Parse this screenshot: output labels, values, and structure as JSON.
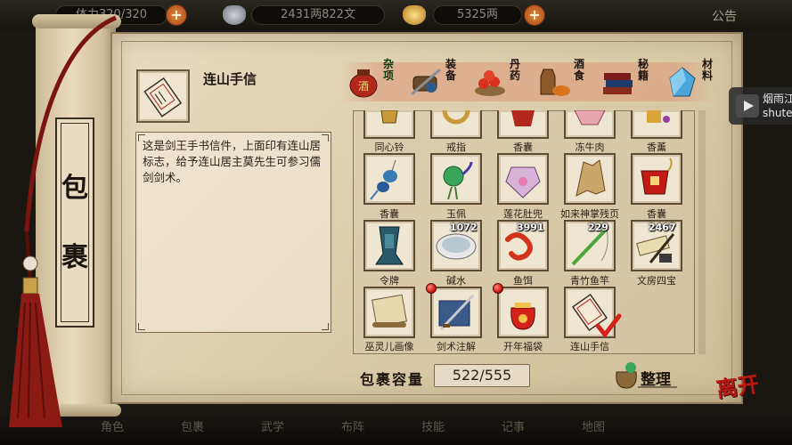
{
  "topbar": {
    "stamina_label": "体力",
    "stamina_value": "320/320",
    "money_value": "2431两822文",
    "gold_value": "5325两",
    "notice_label": "公告",
    "plus_symbol": "+"
  },
  "scroll": {
    "title_chars": [
      "包",
      "裹"
    ]
  },
  "selected": {
    "name": "连山手信",
    "description": "这是剑王手书信件，上面印有连山居标志，给予连山居主莫先生可参习儒剑剑术。"
  },
  "categories": [
    {
      "label": "杂项",
      "icon": "jar-icon",
      "active": true
    },
    {
      "label": "装备",
      "icon": "equipment-icon",
      "active": false
    },
    {
      "label": "丹药",
      "icon": "pills-icon",
      "active": false
    },
    {
      "label": "酒食",
      "icon": "wine-food-icon",
      "active": false
    },
    {
      "label": "秘籍",
      "icon": "books-icon",
      "active": false
    },
    {
      "label": "材料",
      "icon": "crystal-icon",
      "active": false
    }
  ],
  "items": [
    {
      "name": "同心铃",
      "qty": "",
      "icon": "bell-icon",
      "new": false
    },
    {
      "name": "戒指",
      "qty": "",
      "icon": "ring-icon",
      "new": false
    },
    {
      "name": "香囊",
      "qty": "",
      "icon": "sachet-icon",
      "new": false
    },
    {
      "name": "冻牛肉",
      "qty": "",
      "icon": "beef-icon",
      "new": false
    },
    {
      "name": "香薰",
      "qty": "",
      "icon": "incense-icon",
      "new": false
    },
    {
      "name": "香囊",
      "qty": "",
      "icon": "blue-sachet-icon",
      "new": false
    },
    {
      "name": "玉佩",
      "qty": "",
      "icon": "jade-pendant-icon",
      "new": false
    },
    {
      "name": "莲花肚兜",
      "qty": "",
      "icon": "bib-icon",
      "new": false
    },
    {
      "name": "如来神掌残页",
      "qty": "",
      "icon": "torn-page-icon",
      "new": false
    },
    {
      "name": "香囊",
      "qty": "",
      "icon": "red-sachet-icon",
      "new": false
    },
    {
      "name": "令牌",
      "qty": "",
      "icon": "token-icon",
      "new": false
    },
    {
      "name": "碱水",
      "qty": "1072",
      "icon": "bowl-icon",
      "new": false
    },
    {
      "name": "鱼饵",
      "qty": "3991",
      "icon": "worm-icon",
      "new": false
    },
    {
      "name": "青竹鱼竿",
      "qty": "229",
      "icon": "fishing-rod-icon",
      "new": false
    },
    {
      "name": "文房四宝",
      "qty": "2467",
      "icon": "scholar-set-icon",
      "new": false
    },
    {
      "name": "巫灵儿画像",
      "qty": "",
      "icon": "portrait-scroll-icon",
      "new": false
    },
    {
      "name": "剑术注解",
      "qty": "",
      "icon": "sword-manual-icon",
      "new": true
    },
    {
      "name": "开年福袋",
      "qty": "",
      "icon": "lucky-bag-icon",
      "new": true
    },
    {
      "name": "连山手信",
      "qty": "",
      "icon": "letter-icon",
      "new": false,
      "selected": true
    }
  ],
  "footer": {
    "capacity_label": "包裹容量",
    "capacity_value": "522/555",
    "sort_label": "整理",
    "leave_label": "离开"
  },
  "bottom_tabs": [
    "角色",
    "包裹",
    "武学",
    "布阵",
    "技能",
    "记事",
    "地图"
  ],
  "overlay": {
    "line1": "烟雨江",
    "line2": "shute"
  }
}
